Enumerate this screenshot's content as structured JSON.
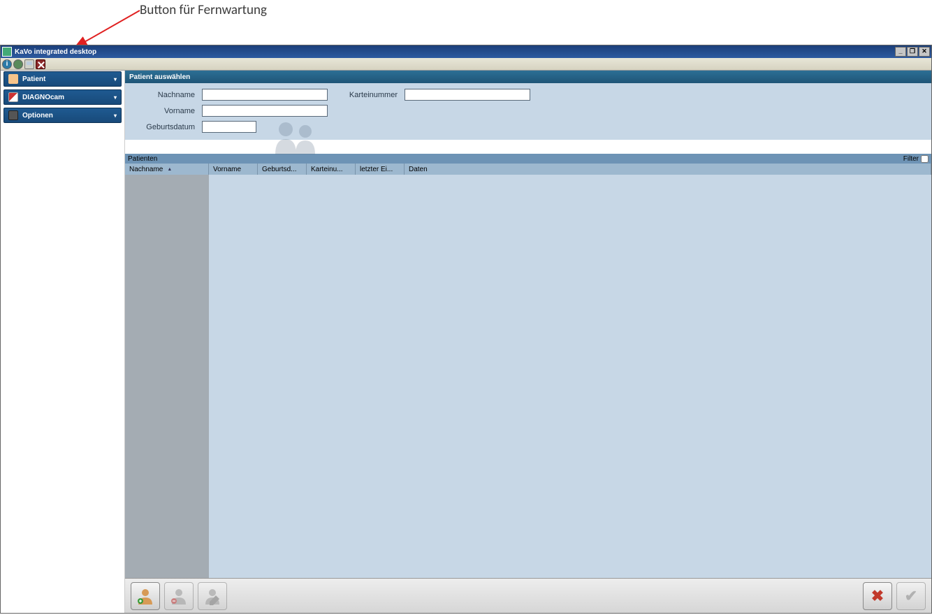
{
  "annotation": "Button für Fernwartung",
  "window": {
    "title": "KaVo integrated desktop",
    "controls": {
      "min": "_",
      "max": "❐",
      "close": "✕"
    }
  },
  "toolbar": {
    "info_tip": "Info",
    "globe_tip": "Web",
    "remote_tip": "Fernwartung",
    "stop_tip": "Stop"
  },
  "sidebar": {
    "items": [
      {
        "label": "Patient"
      },
      {
        "label": "DIAGNOcam"
      },
      {
        "label": "Optionen"
      }
    ]
  },
  "panel": {
    "title": "Patient auswählen",
    "fields": {
      "nachname_label": "Nachname",
      "vorname_label": "Vorname",
      "geburtsdatum_label": "Geburtsdatum",
      "karteinummer_label": "Karteinummer"
    }
  },
  "list": {
    "title": "Patienten",
    "filter_label": "Filter",
    "columns": {
      "nachname": "Nachname",
      "vorname": "Vorname",
      "geburtsd": "Geburtsd...",
      "karteinu": "Karteinu...",
      "letzter": "letzter Ei...",
      "daten": "Daten"
    }
  },
  "buttons": {
    "add_tip": "Neuer Patient",
    "remove_tip": "Patient löschen",
    "edit_tip": "Patient bearbeiten",
    "cancel_tip": "Abbrechen",
    "ok_tip": "OK"
  }
}
